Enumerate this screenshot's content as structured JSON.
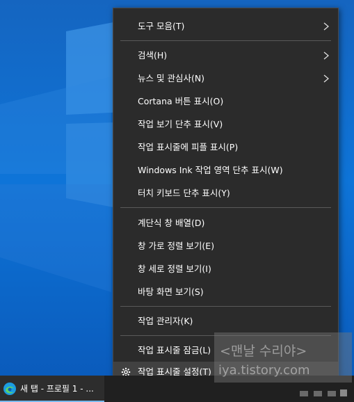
{
  "menu": {
    "items": [
      {
        "label": "도구 모음(T)",
        "submenu": true
      },
      {
        "label": "검색(H)",
        "submenu": true
      },
      {
        "label": "뉴스 및 관심사(N)",
        "submenu": true
      },
      {
        "label": "Cortana 버튼 표시(O)"
      },
      {
        "label": "작업 보기 단추 표시(V)"
      },
      {
        "label": "작업 표시줄에 피플 표시(P)"
      },
      {
        "label": "Windows Ink 작업 영역 단추 표시(W)"
      },
      {
        "label": "터치 키보드 단추 표시(Y)"
      },
      {
        "label": "계단식 창 배열(D)"
      },
      {
        "label": "창 가로 정렬 보기(E)"
      },
      {
        "label": "창 세로 정렬 보기(I)"
      },
      {
        "label": "바탕 화면 보기(S)"
      },
      {
        "label": "작업 관리자(K)"
      },
      {
        "label": "작업 표시줄 잠금(L)"
      },
      {
        "label": "작업 표시줄 설정(T)",
        "icon": "gear-icon",
        "highlighted": true
      }
    ]
  },
  "taskbar": {
    "app_label": "새 탭 - 프로필 1 - ...",
    "app_icon": "edge-icon"
  },
  "watermark": {
    "line1": "<맨날 수리야>",
    "line2": "iya.tistory.com"
  },
  "colors": {
    "menu_bg": "#2b2b2b",
    "highlight": "#414141",
    "taskbar_bg": "#202020",
    "desktop_blue": "#0e74d8"
  }
}
